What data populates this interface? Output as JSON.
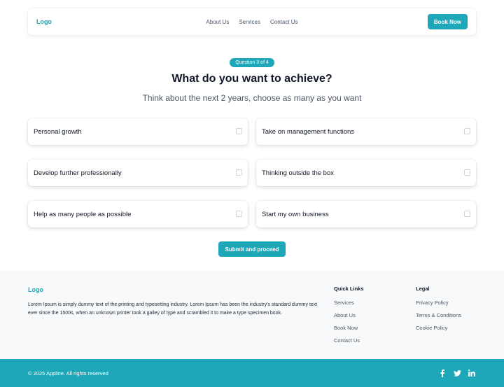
{
  "header": {
    "logo": "Logo",
    "nav": [
      "About Us",
      "Services",
      "Contact Us"
    ],
    "book_label": "Book Now"
  },
  "quiz": {
    "badge": "Question 3 of 4",
    "title": "What do you want to achieve?",
    "subtitle": "Think about the next 2 years, choose as many as you want",
    "options": [
      "Personal growth",
      "Take on management functions",
      "Develop further professionally",
      "Thinking outside the box",
      "Help as many people as possible",
      "Start my own business"
    ],
    "submit_label": "Submit and proceed"
  },
  "footer": {
    "logo": "Logo",
    "description": "Lorem Ipsum is simply dummy text of the printing and typesetting industry. Lorem Ipsum has been the industry's standard dummy text ever since the 1500s, when an unknown printer took a galley of type and scrambled it to make a type specimen book.",
    "quick_links_title": "Quick Links",
    "quick_links": [
      "Services",
      "About Us",
      "Book Now",
      "Contact Us"
    ],
    "legal_title": "Legal",
    "legal_links": [
      "Privacy Policy",
      "Terms & Conditions",
      "Cookie Policy"
    ],
    "copyright": "© 2025 Appline. All rights reserved",
    "socials": [
      "facebook-icon",
      "twitter-icon",
      "linkedin-icon"
    ]
  },
  "colors": {
    "accent": "#1ea7b8",
    "footer_bg": "#f8f9fa"
  }
}
